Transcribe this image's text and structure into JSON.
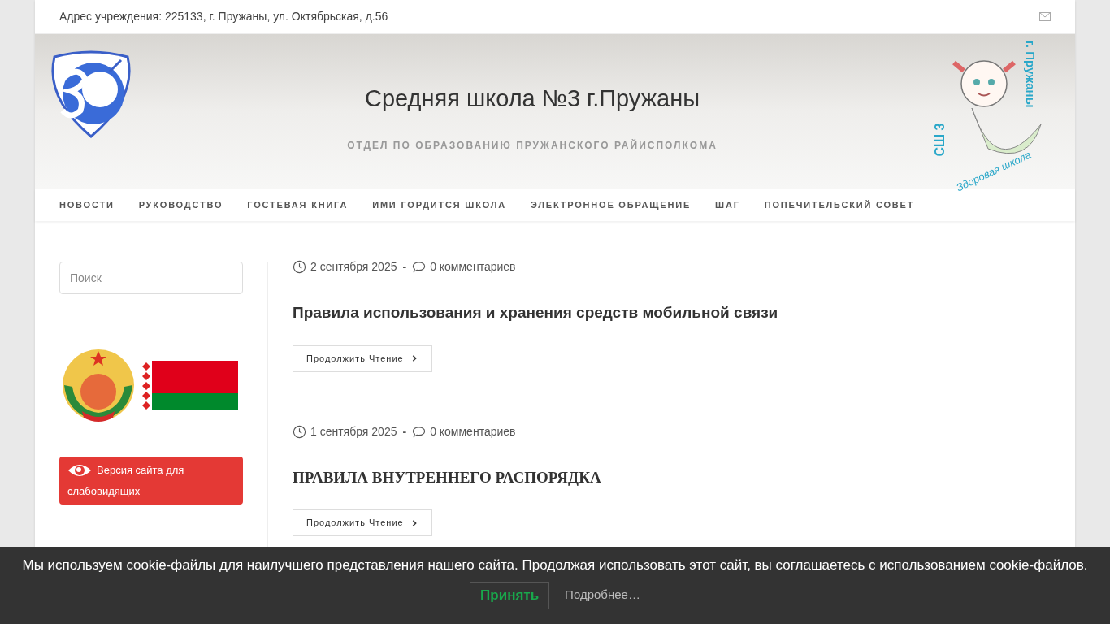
{
  "top_bar": {
    "address": "Адрес учреждения: 225133, г. Пружаны, ул. Октябрьская, д.56"
  },
  "header": {
    "title": "Средняя школа №3 г.Пружаны",
    "subtitle": "ОТДЕЛ ПО ОБРАЗОВАНИЮ ПРУЖАНСКОГО РАЙИСПОЛКОМА",
    "mascot_text": [
      "г. Пружаны",
      "СШ 3",
      "Здоровая школа"
    ]
  },
  "nav": [
    "НОВОСТИ",
    "РУКОВОДСТВО",
    "ГОСТЕВАЯ КНИГА",
    "ИМИ ГОРДИТСЯ ШКОЛА",
    "ЭЛЕКТРОННОЕ ОБРАЩЕНИЕ",
    "ШАГ",
    "ПОПЕЧИТЕЛЬСКИЙ СОВЕТ"
  ],
  "sidebar": {
    "search": {
      "placeholder": "Поиск"
    },
    "accessibility_button": "Версия сайта для слабовидящих"
  },
  "posts": [
    {
      "date": "2 сентября 2025",
      "separator": "-",
      "comments": "0 комментариев",
      "title": "Правила использования и хранения средств мобильной связи",
      "kind": "sans",
      "button": "Продолжить Чтение"
    },
    {
      "date": "1 сентября 2025",
      "separator": "-",
      "comments": "0 комментариев",
      "title": "ПРАВИЛА ВНУТРЕННЕГО РАСПОРЯДКА",
      "kind": "serif",
      "button": "Продолжить Чтение"
    }
  ],
  "cookie_banner": {
    "text": "Мы используем cookie-файлы для наилучшего представления нашего сайта. Продолжая использовать этот сайт, вы соглашаетесь с использованием cookie-файлов.",
    "accept": "Принять",
    "more": "Подробнее…"
  }
}
